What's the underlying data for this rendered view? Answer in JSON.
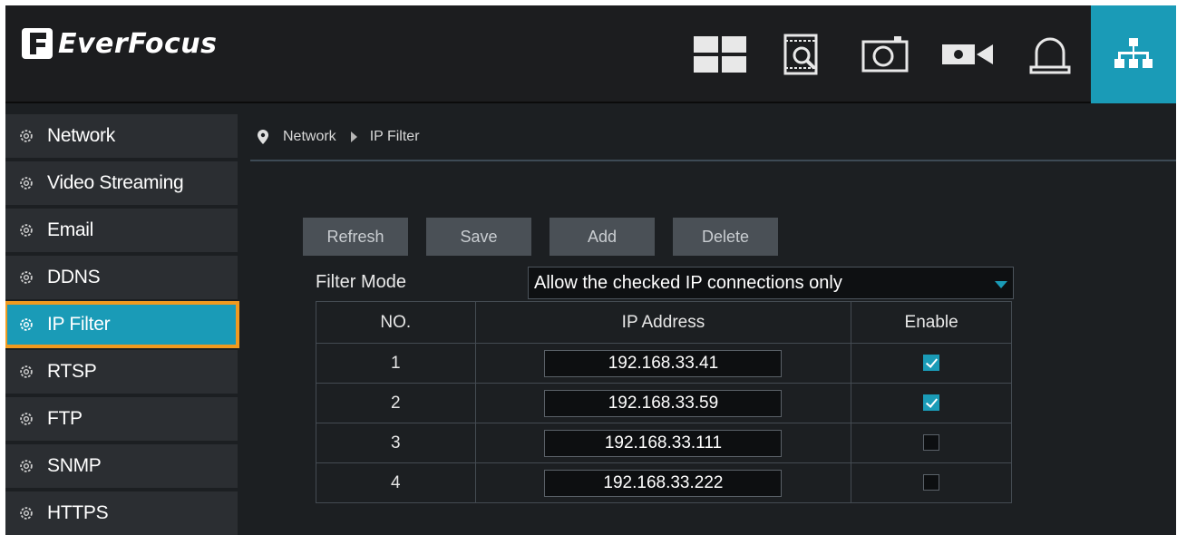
{
  "brand": {
    "name": "EverFocus"
  },
  "colors": {
    "accent": "#1a9bb7",
    "highlight_outline": "#f19a1f",
    "background": "#1c1f22"
  },
  "topnav": {
    "items": [
      {
        "icon": "live-view-grid-icon",
        "active": false
      },
      {
        "icon": "playback-search-icon",
        "active": false
      },
      {
        "icon": "snapshot-camera-icon",
        "active": false
      },
      {
        "icon": "video-camera-icon",
        "active": false
      },
      {
        "icon": "alarm-bell-icon",
        "active": false
      },
      {
        "icon": "network-sitemap-icon",
        "active": true
      }
    ]
  },
  "sidebar": {
    "items": [
      {
        "label": "Network",
        "icon": "gear-icon"
      },
      {
        "label": "Video Streaming",
        "icon": "gear-icon"
      },
      {
        "label": "Email",
        "icon": "gear-icon"
      },
      {
        "label": "DDNS",
        "icon": "gear-icon"
      },
      {
        "label": "IP Filter",
        "icon": "gear-icon",
        "active": true
      },
      {
        "label": "RTSP",
        "icon": "gear-icon"
      },
      {
        "label": "FTP",
        "icon": "gear-icon"
      },
      {
        "label": "SNMP",
        "icon": "gear-icon"
      },
      {
        "label": "HTTPS",
        "icon": "gear-icon"
      }
    ]
  },
  "breadcrumb": {
    "parent": "Network",
    "current": "IP Filter"
  },
  "toolbar": {
    "refresh": "Refresh",
    "save": "Save",
    "add": "Add",
    "delete": "Delete"
  },
  "filter_mode": {
    "label": "Filter Mode",
    "value": "Allow the checked IP connections only"
  },
  "table": {
    "headers": [
      "NO.",
      "IP Address",
      "Enable"
    ],
    "rows": [
      {
        "no": "1",
        "ip": "192.168.33.41",
        "enabled": true
      },
      {
        "no": "2",
        "ip": "192.168.33.59",
        "enabled": true
      },
      {
        "no": "3",
        "ip": "192.168.33.111",
        "enabled": false
      },
      {
        "no": "4",
        "ip": "192.168.33.222",
        "enabled": false
      }
    ]
  }
}
